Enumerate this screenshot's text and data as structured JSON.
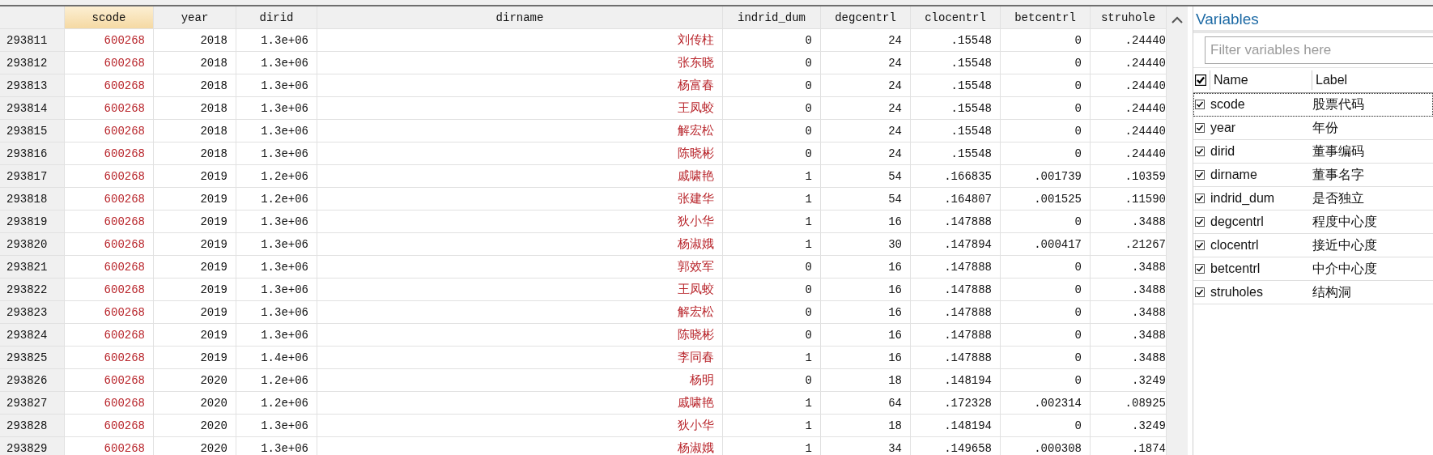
{
  "table": {
    "columns": [
      {
        "label": "scode",
        "kind": "string",
        "selected": true
      },
      {
        "label": "year",
        "kind": "numeric",
        "selected": false
      },
      {
        "label": "dirid",
        "kind": "numeric",
        "selected": false
      },
      {
        "label": "dirname",
        "kind": "string",
        "selected": false
      },
      {
        "label": "indrid_dum",
        "kind": "numeric",
        "selected": false
      },
      {
        "label": "degcentrl",
        "kind": "numeric",
        "selected": false
      },
      {
        "label": "clocentrl",
        "kind": "numeric",
        "selected": false
      },
      {
        "label": "betcentrl",
        "kind": "numeric",
        "selected": false
      },
      {
        "label": "struhole",
        "kind": "numeric",
        "selected": false
      }
    ],
    "rows": [
      {
        "row_number": "293811",
        "cells": [
          "600268",
          "2018",
          "1.3e+06",
          "刘传柱",
          "0",
          "24",
          ".15548",
          "0",
          ".24440"
        ]
      },
      {
        "row_number": "293812",
        "cells": [
          "600268",
          "2018",
          "1.3e+06",
          "张东晓",
          "0",
          "24",
          ".15548",
          "0",
          ".24440"
        ]
      },
      {
        "row_number": "293813",
        "cells": [
          "600268",
          "2018",
          "1.3e+06",
          "杨富春",
          "0",
          "24",
          ".15548",
          "0",
          ".24440"
        ]
      },
      {
        "row_number": "293814",
        "cells": [
          "600268",
          "2018",
          "1.3e+06",
          "王凤蛟",
          "0",
          "24",
          ".15548",
          "0",
          ".24440"
        ]
      },
      {
        "row_number": "293815",
        "cells": [
          "600268",
          "2018",
          "1.3e+06",
          "解宏松",
          "0",
          "24",
          ".15548",
          "0",
          ".24440"
        ]
      },
      {
        "row_number": "293816",
        "cells": [
          "600268",
          "2018",
          "1.3e+06",
          "陈晓彬",
          "0",
          "24",
          ".15548",
          "0",
          ".24440"
        ]
      },
      {
        "row_number": "293817",
        "cells": [
          "600268",
          "2019",
          "1.2e+06",
          "戚啸艳",
          "1",
          "54",
          ".166835",
          ".001739",
          ".10359"
        ]
      },
      {
        "row_number": "293818",
        "cells": [
          "600268",
          "2019",
          "1.2e+06",
          "张建华",
          "1",
          "54",
          ".164807",
          ".001525",
          ".11590"
        ]
      },
      {
        "row_number": "293819",
        "cells": [
          "600268",
          "2019",
          "1.3e+06",
          "狄小华",
          "1",
          "16",
          ".147888",
          "0",
          ".3488"
        ]
      },
      {
        "row_number": "293820",
        "cells": [
          "600268",
          "2019",
          "1.3e+06",
          "杨淑娥",
          "1",
          "30",
          ".147894",
          ".000417",
          ".21267"
        ]
      },
      {
        "row_number": "293821",
        "cells": [
          "600268",
          "2019",
          "1.3e+06",
          "郭效军",
          "0",
          "16",
          ".147888",
          "0",
          ".3488"
        ]
      },
      {
        "row_number": "293822",
        "cells": [
          "600268",
          "2019",
          "1.3e+06",
          "王凤蛟",
          "0",
          "16",
          ".147888",
          "0",
          ".3488"
        ]
      },
      {
        "row_number": "293823",
        "cells": [
          "600268",
          "2019",
          "1.3e+06",
          "解宏松",
          "0",
          "16",
          ".147888",
          "0",
          ".3488"
        ]
      },
      {
        "row_number": "293824",
        "cells": [
          "600268",
          "2019",
          "1.3e+06",
          "陈晓彬",
          "0",
          "16",
          ".147888",
          "0",
          ".3488"
        ]
      },
      {
        "row_number": "293825",
        "cells": [
          "600268",
          "2019",
          "1.4e+06",
          "李同春",
          "1",
          "16",
          ".147888",
          "0",
          ".3488"
        ]
      },
      {
        "row_number": "293826",
        "cells": [
          "600268",
          "2020",
          "1.2e+06",
          "杨明",
          "0",
          "18",
          ".148194",
          "0",
          ".3249"
        ]
      },
      {
        "row_number": "293827",
        "cells": [
          "600268",
          "2020",
          "1.2e+06",
          "戚啸艳",
          "1",
          "64",
          ".172328",
          ".002314",
          ".08925"
        ]
      },
      {
        "row_number": "293828",
        "cells": [
          "600268",
          "2020",
          "1.3e+06",
          "狄小华",
          "1",
          "18",
          ".148194",
          "0",
          ".3249"
        ]
      },
      {
        "row_number": "293829",
        "cells": [
          "600268",
          "2020",
          "1.3e+06",
          "杨淑娥",
          "1",
          "34",
          ".149658",
          ".000308",
          ".1874"
        ]
      }
    ]
  },
  "variables_panel": {
    "title": "Variables",
    "filter": {
      "placeholder": "Filter variables here"
    },
    "header": {
      "checked": true,
      "name": "Name",
      "label": "Label"
    },
    "items": [
      {
        "name": "scode",
        "label": "股票代码",
        "checked": true,
        "selected": true
      },
      {
        "name": "year",
        "label": "年份",
        "checked": true,
        "selected": false
      },
      {
        "name": "dirid",
        "label": "董事编码",
        "checked": true,
        "selected": false
      },
      {
        "name": "dirname",
        "label": "董事名字",
        "checked": true,
        "selected": false
      },
      {
        "name": "indrid_dum",
        "label": "是否独立",
        "checked": true,
        "selected": false
      },
      {
        "name": "degcentrl",
        "label": "程度中心度",
        "checked": true,
        "selected": false
      },
      {
        "name": "clocentrl",
        "label": "接近中心度",
        "checked": true,
        "selected": false
      },
      {
        "name": "betcentrl",
        "label": "中介中心度",
        "checked": true,
        "selected": false
      },
      {
        "name": "struholes",
        "label": "结构洞",
        "checked": true,
        "selected": false
      }
    ]
  }
}
